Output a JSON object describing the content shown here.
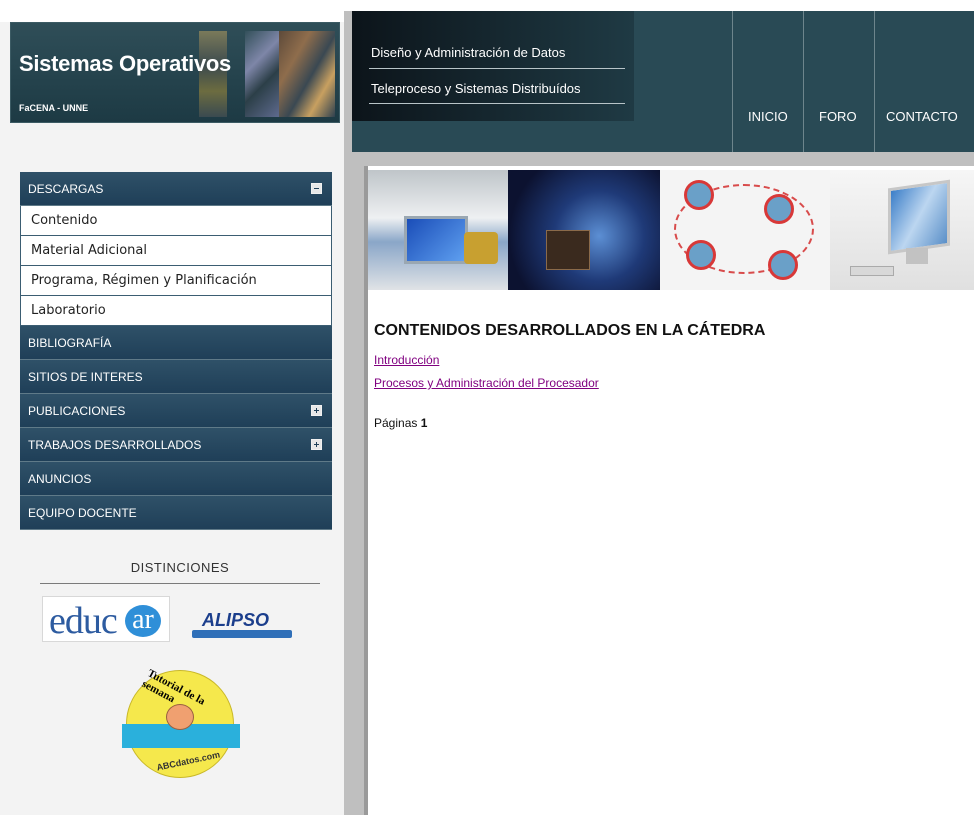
{
  "header": {
    "title": "Sistemas Operativos",
    "subtitle": "FaCENA - UNNE"
  },
  "top_links": [
    "Diseño y Administración de Datos",
    "Teleproceso y Sistemas Distribuídos"
  ],
  "nav": [
    "INICIO",
    "FORO",
    "CONTACTO"
  ],
  "sidebar": {
    "descargas": {
      "label": "DESCARGAS",
      "items": [
        "Contenido",
        "Material Adicional",
        "Programa, Régimen y Planificación",
        "Laboratorio"
      ]
    },
    "bibliografia": "BIBLIOGRAFÍA",
    "sitios": "SITIOS DE INTERES",
    "publicaciones": "PUBLICACIONES",
    "trabajos": "TRABAJOS DESARROLLADOS",
    "anuncios": "ANUNCIOS",
    "equipo": "EQUIPO DOCENTE"
  },
  "distinctions": {
    "title": "DISTINCIONES",
    "educar": "educ",
    "educar_ar": "ar",
    "alipso": "ALIPSO",
    "tutorial": "Tutorial de la semana",
    "abcdatos": "ABCdatos.com"
  },
  "content": {
    "title": "CONTENIDOS DESARROLLADOS EN LA CÁTEDRA",
    "links": [
      "Introducción",
      "Procesos y Administración del Procesador"
    ],
    "pages_label": "Páginas",
    "pages_value": "1"
  },
  "colors": {
    "header_bg": "#294a55",
    "menu_bg": "#1f3f58",
    "link_visited": "#800080"
  }
}
